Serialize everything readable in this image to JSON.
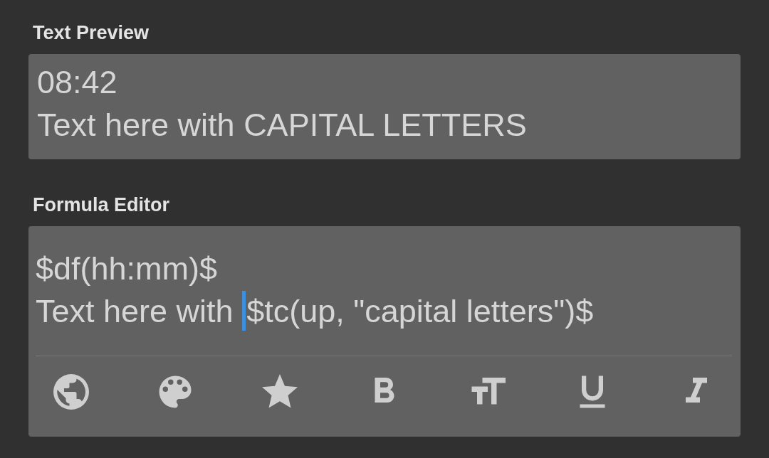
{
  "preview": {
    "title": "Text Preview",
    "lines": [
      "08:42",
      "Text here with CAPITAL LETTERS"
    ]
  },
  "editor": {
    "title": "Formula Editor",
    "lines": [
      {
        "before_cursor": "$df(hh:mm)$",
        "has_cursor": false
      },
      {
        "before_cursor": "Text here with ",
        "after_cursor": "$tc(up, \"capital letters\")$",
        "has_cursor": true
      }
    ],
    "toolbar": [
      {
        "kind": "globe"
      },
      {
        "kind": "palette"
      },
      {
        "kind": "star"
      },
      {
        "kind": "bold"
      },
      {
        "kind": "text-size"
      },
      {
        "kind": "underline"
      },
      {
        "kind": "italic"
      }
    ]
  }
}
